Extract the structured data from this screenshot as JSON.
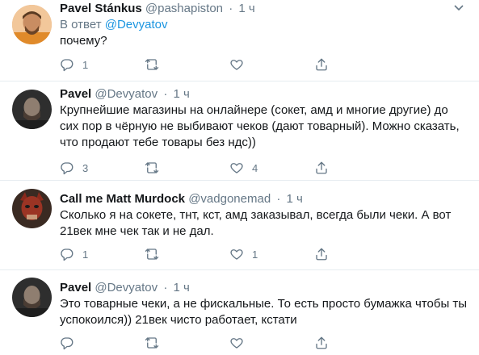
{
  "tweets": [
    {
      "name": "Pavel Stánkus",
      "handle": "@pashapiston",
      "dot": "·",
      "time": "1 ч",
      "reply_prefix": "В ответ",
      "reply_to": "@Devyatov",
      "text": "почему?",
      "reply_count": "1",
      "retweet_count": "",
      "like_count": "",
      "avatar_color": "#d9a066"
    },
    {
      "name": "Pavel",
      "handle": "@Devyatov",
      "dot": "·",
      "time": "1 ч",
      "text": "Крупнейшие магазины на онлайнере (сокет, амд и многие другие) до сих пор в чёрную не выбивают чеков (дают товарный). Можно сказать, что продают тебе товары без ндс))",
      "reply_count": "3",
      "retweet_count": "",
      "like_count": "4",
      "avatar_color": "#3a3a3a"
    },
    {
      "name": "Call me Matt Murdock",
      "handle": "@vadgonemad",
      "dot": "·",
      "time": "1 ч",
      "text": "Сколько я на сокете, тнт, кст, амд заказывал, всегда были чеки. А вот 21век мне чек так и не дал.",
      "reply_count": "1",
      "retweet_count": "",
      "like_count": "1",
      "avatar_color": "#7a2a1e"
    },
    {
      "name": "Pavel",
      "handle": "@Devyatov",
      "dot": "·",
      "time": "1 ч",
      "text": "Это товарные чеки, а не фискальные. То есть просто бумажка чтобы ты успокоился)) 21век чисто работает, кстати",
      "reply_count": "",
      "retweet_count": "",
      "like_count": "",
      "avatar_color": "#3a3a3a"
    }
  ],
  "colors": {
    "link": "#1b95e0",
    "muted": "#657786",
    "divider": "#e6ecf0",
    "text": "#14171a"
  }
}
